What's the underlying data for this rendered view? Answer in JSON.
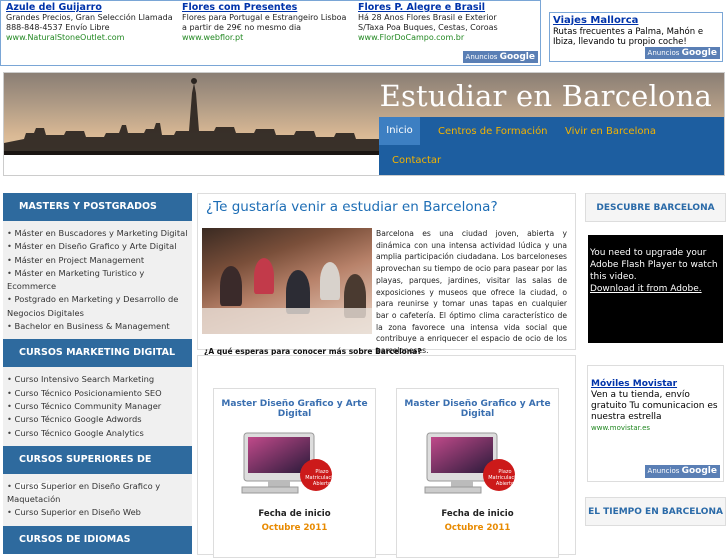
{
  "top_ads": [
    {
      "title": "Azule del Guijarro",
      "line1": "Grandes Precios, Gran Selección Llamada",
      "line2": "888-848-4537 Envío Libre",
      "url": "www.NaturalStoneOutlet.com"
    },
    {
      "title": "Flores com Presentes",
      "line1": "Flores para Portugal e Estrangeiro Lisboa",
      "line2": "a partir de 29€ no mesmo dia",
      "url": "www.webflor.pt"
    },
    {
      "title": "Flores P. Alegre e Brasil",
      "line1": "Há 28 Anos Flores Brasil e Exterior",
      "line2": "S/Taxa Poa Buques, Cestas, Coroas",
      "url": "www.FlorDoCampo.com.br"
    }
  ],
  "ads_by_label": "Anuncios",
  "ads_by_brand": "Google",
  "right_top_ad": {
    "title": "Viajes Mallorca",
    "text": "Rutas frecuentes a Palma, Mahón e Ibiza, llevando tu propio coche!"
  },
  "site": {
    "title": "Estudiar en Barcelona"
  },
  "nav": [
    {
      "label": "Inicio"
    },
    {
      "label": "Centros de Formación"
    },
    {
      "label": "Vivir en Barcelona"
    },
    {
      "label": "Contactar"
    }
  ],
  "sidebar": {
    "sections": [
      {
        "title": "MASTERS Y POSTGRADOS",
        "items": [
          "Máster en Buscadores y Marketing Digital",
          "Máster en Diseño Grafico y Arte Digital",
          "Máster en Project Management",
          "Máster en Marketing Turistico y    Ecommerce",
          "Postgrado en Marketing y Desarrollo de    Negocios Digitales",
          "Bachelor en Business & Management"
        ]
      },
      {
        "title": "CURSOS MARKETING DIGITAL",
        "items": [
          "Curso Intensivo Search Marketing",
          "Curso Técnico Posicionamiento SEO",
          "Curso Técnico Community Manager",
          "Curso Técnico Google Adwords",
          "Curso Técnico Google Analytics"
        ]
      },
      {
        "title": "CURSOS SUPERIORES DE DISEÑO",
        "items": [
          "Curso Superior en Diseño Grafico y    Maquetación",
          "Curso Superior en Diseño Web"
        ]
      },
      {
        "title": "CURSOS DE IDIOMAS",
        "items": []
      }
    ]
  },
  "main": {
    "heading": "¿Te gustaría venir a estudiar en Barcelona?",
    "paragraph": "Barcelona es una ciudad joven, abierta y dinámica con una intensa actividad lúdica y una amplia participación ciudadana. Los barceloneses aprovechan su tiempo de ocio para pasear por las playas, parques, jardines, visitar las salas de exposiciones y museos que ofrece la ciudad, o para reunirse y tomar unas tapas en cualquier bar o cafetería. El óptimo clima característico de la zona favorece una intensa vida social que contribuye a enriquecer el espacio de ocio de los barceloneses.",
    "question": "¿A qué esperas para conocer más sobre Barcelona?"
  },
  "cards": [
    {
      "title": "Master Diseño Grafico y Arte Digital",
      "badge": "Plazo Matriculación Abierto",
      "start_label": "Fecha de inicio",
      "start_value": "Octubre 2011"
    },
    {
      "title": "Master Diseño Grafico y Arte Digital",
      "badge": "Plazo Matriculación Abierto",
      "start_label": "Fecha de inicio",
      "start_value": "Octubre 2011"
    }
  ],
  "right": {
    "discover": "DESCUBRE BARCELONA",
    "flash_text": "You need to upgrade your Adobe Flash Player to watch this video.",
    "flash_link": "Download it from Adobe.",
    "ad": {
      "title": "Móviles Movistar",
      "text": "Ven a tu tienda, envío gratuito Tu comunicacion es nuestra estrella",
      "url": "www.movistar.es"
    },
    "weather": "EL TIEMPO EN BARCELONA"
  }
}
